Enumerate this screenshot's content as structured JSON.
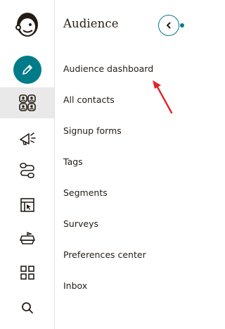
{
  "rail": {
    "icons": [
      "mailchimp-logo-icon",
      "pencil-icon",
      "audience-icon",
      "campaigns-megaphone-icon",
      "automations-icon",
      "website-icon",
      "content-studio-icon",
      "integrations-grid-icon",
      "search-icon"
    ]
  },
  "panel": {
    "title": "Audience",
    "items": [
      {
        "label": "Audience dashboard"
      },
      {
        "label": "All contacts"
      },
      {
        "label": "Signup forms"
      },
      {
        "label": "Tags"
      },
      {
        "label": "Segments"
      },
      {
        "label": "Surveys"
      },
      {
        "label": "Preferences center"
      },
      {
        "label": "Inbox"
      }
    ]
  },
  "colors": {
    "accent": "#007c89",
    "annotation_arrow": "#e0242a",
    "active_rail_bg": "#e9e9e9"
  }
}
